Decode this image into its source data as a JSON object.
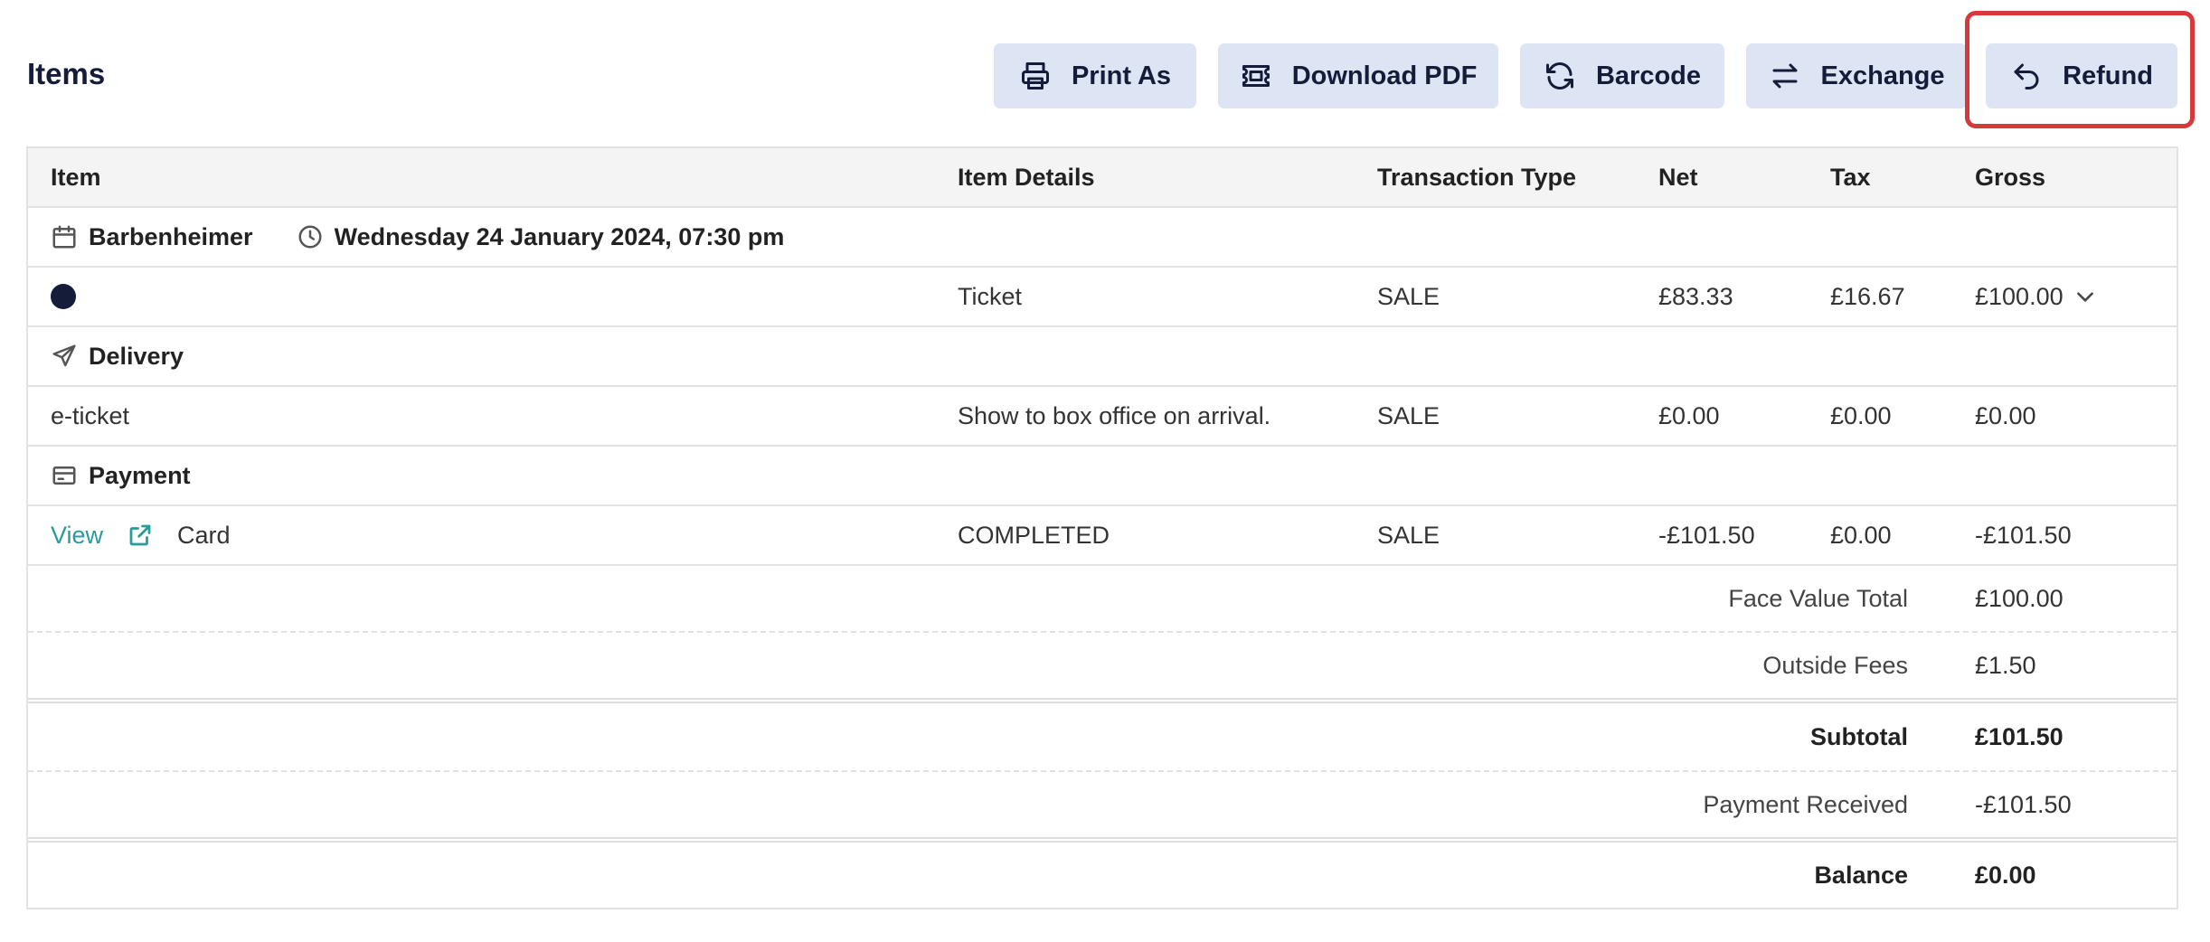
{
  "page": {
    "title": "Items"
  },
  "toolbar": {
    "print_label": "Print As",
    "download_label": "Download PDF",
    "barcode_label": "Barcode",
    "exchange_label": "Exchange",
    "refund_label": "Refund"
  },
  "table": {
    "headers": [
      "Item",
      "Item Details",
      "Transaction Type",
      "Net",
      "Tax",
      "Gross"
    ],
    "event": {
      "name": "Barbenheimer",
      "datetime": "Wednesday 24 January 2024, 07:30 pm"
    },
    "ticket_row": {
      "details": "Ticket",
      "type": "SALE",
      "net": "£83.33",
      "tax": "£16.67",
      "gross": "£100.00"
    },
    "delivery_section": "Delivery",
    "delivery_row": {
      "item": "e-ticket",
      "details": "Show to box office on arrival.",
      "type": "SALE",
      "net": "£0.00",
      "tax": "£0.00",
      "gross": "£0.00"
    },
    "payment_section": "Payment",
    "payment_row": {
      "link": "View",
      "item": "Card",
      "details": "COMPLETED",
      "type": "SALE",
      "net": "-£101.50",
      "tax": "£0.00",
      "gross": "-£101.50"
    }
  },
  "summary": {
    "face_value_label": "Face Value Total",
    "face_value": "£100.00",
    "outside_fees_label": "Outside Fees",
    "outside_fees": "£1.50",
    "subtotal_label": "Subtotal",
    "subtotal": "£101.50",
    "payment_received_label": "Payment Received",
    "payment_received": "-£101.50",
    "balance_label": "Balance",
    "balance": "£0.00"
  },
  "colors": {
    "accent": "#141c3a",
    "button_bg": "#dde4f3",
    "link": "#2a9b9b",
    "highlight": "#d6383c"
  }
}
